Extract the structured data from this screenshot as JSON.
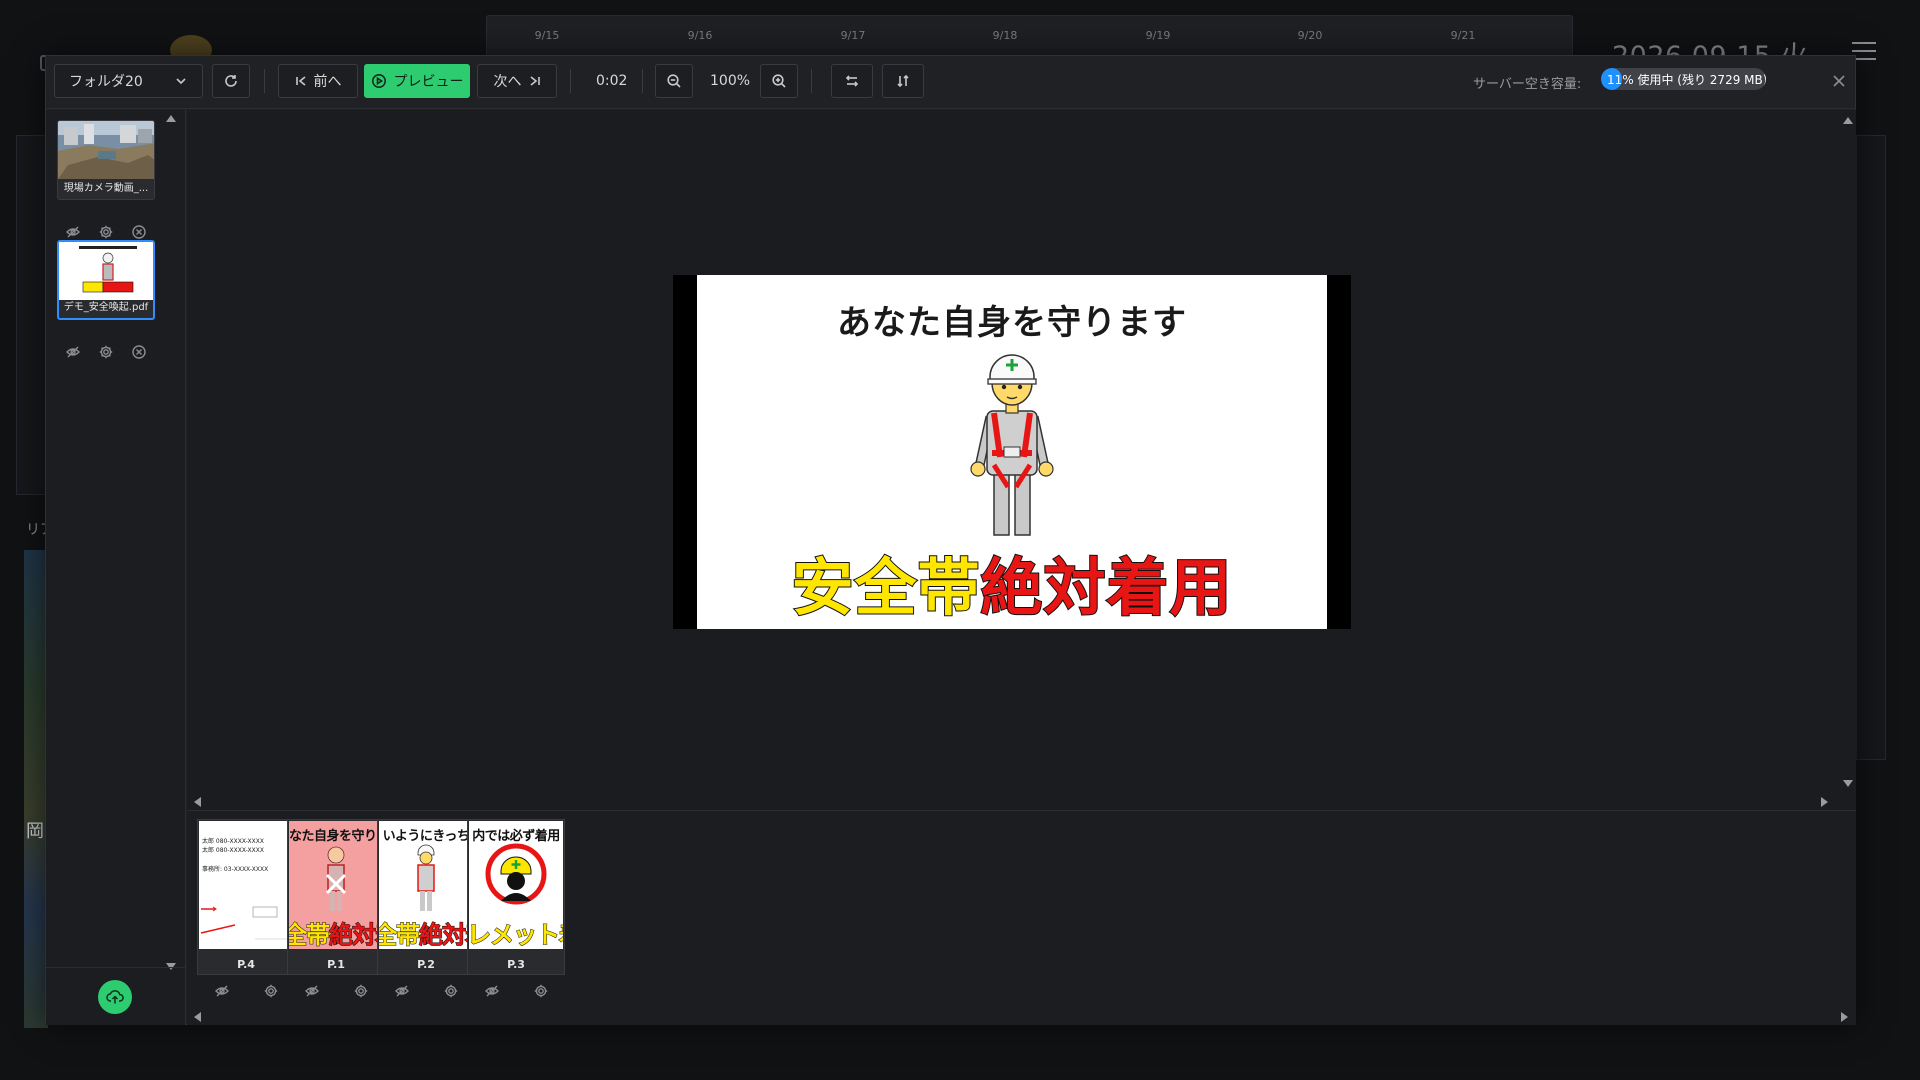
{
  "background": {
    "timeline_dates": [
      "9/15",
      "9/16",
      "9/17",
      "9/18",
      "9/19",
      "9/20",
      "9/21"
    ],
    "clock": "2026.09.15 火",
    "left_labels": [
      "リア",
      "岡"
    ]
  },
  "toolbar": {
    "folder_select": "フォルダ20",
    "prev_label": "前へ",
    "preview_label": "プレビュー",
    "next_label": "次へ",
    "time": "0:02",
    "zoom": "100%",
    "storage_label": "サーバー空き容量:",
    "storage_text": "11% 使用中 (残り 2729 MB)",
    "storage_used_percent": 11
  },
  "files": [
    {
      "name": "現場カメラ動画_...",
      "active": false
    },
    {
      "name": "デモ_安全喚起.pdf",
      "active": true
    }
  ],
  "slide": {
    "top_text": "あなた自身を守ります",
    "bottom_yellow": "安全帯",
    "bottom_red": "絶対着用"
  },
  "pages": [
    {
      "label": "P.4",
      "lines": [
        "太郎 080-XXXX-XXXX",
        "太郎 080-XXXX-XXXX",
        "事務所: 03-XXXX-XXXX"
      ]
    },
    {
      "label": "P.1",
      "top": "なた自身を守りま",
      "yellow": "全帯",
      "red": "絶対着",
      "excluded": true
    },
    {
      "label": "P.2",
      "top": "いようにきっち",
      "yellow": "全帯",
      "red": "絶対着"
    },
    {
      "label": "P.3",
      "top": "内では必ず着用",
      "yellow": "レメット着",
      "red": ""
    }
  ],
  "colors": {
    "accent_green": "#2ecc71",
    "accent_blue": "#2f8dff",
    "storage_blue": "#1e90ff",
    "excluded_pink": "#f5a0a0"
  },
  "icons": [
    "refresh-icon",
    "skip-prev-icon",
    "play-circle-icon",
    "skip-next-icon",
    "zoom-out-icon",
    "zoom-in-icon",
    "flip-horizontal-icon",
    "flip-vertical-icon",
    "close-icon",
    "eye-off-icon",
    "gear-icon",
    "remove-circle-icon",
    "upload-icon",
    "chevron-down-icon",
    "scroll-arrow-icon"
  ]
}
